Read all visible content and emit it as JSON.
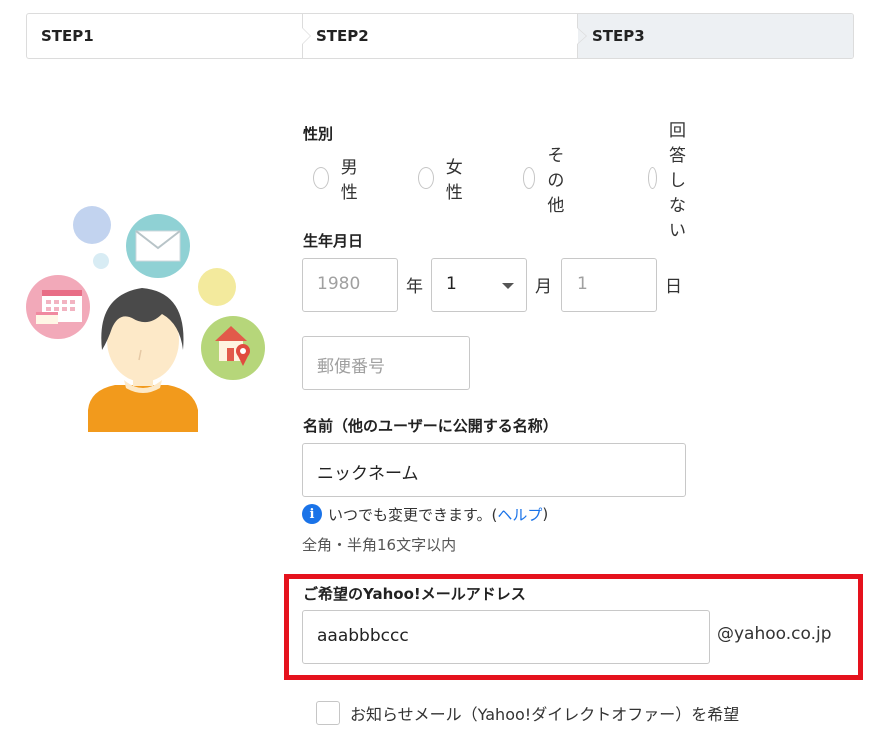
{
  "steps": [
    {
      "label": "STEP1"
    },
    {
      "label": "STEP2"
    },
    {
      "label": "STEP3"
    }
  ],
  "gender": {
    "label": "性別",
    "options": [
      "男性",
      "女性",
      "その他",
      "回答しない"
    ]
  },
  "birthdate": {
    "label": "生年月日",
    "year_placeholder": "1980",
    "year_unit": "年",
    "month_value": "1",
    "month_unit": "月",
    "day_placeholder": "1",
    "day_unit": "日"
  },
  "postal": {
    "placeholder": "郵便番号"
  },
  "nickname": {
    "label": "名前（他のユーザーに公開する名称）",
    "value": "ニックネーム",
    "info_text": "いつでも変更できます。(",
    "help_link": "ヘルプ",
    "info_close": ")",
    "note": "全角・半角16文字以内"
  },
  "email": {
    "label": "ご希望のYahoo!メールアドレス",
    "value": "aaabbbccc",
    "domain": "@yahoo.co.jp"
  },
  "newsletter": {
    "label": "お知らせメール（Yahoo!ダイレクトオファー）を希望"
  },
  "colors": {
    "accent_blue": "#1a73e8",
    "highlight_red": "#e5121d",
    "active_step_bg": "#edf0f3"
  }
}
